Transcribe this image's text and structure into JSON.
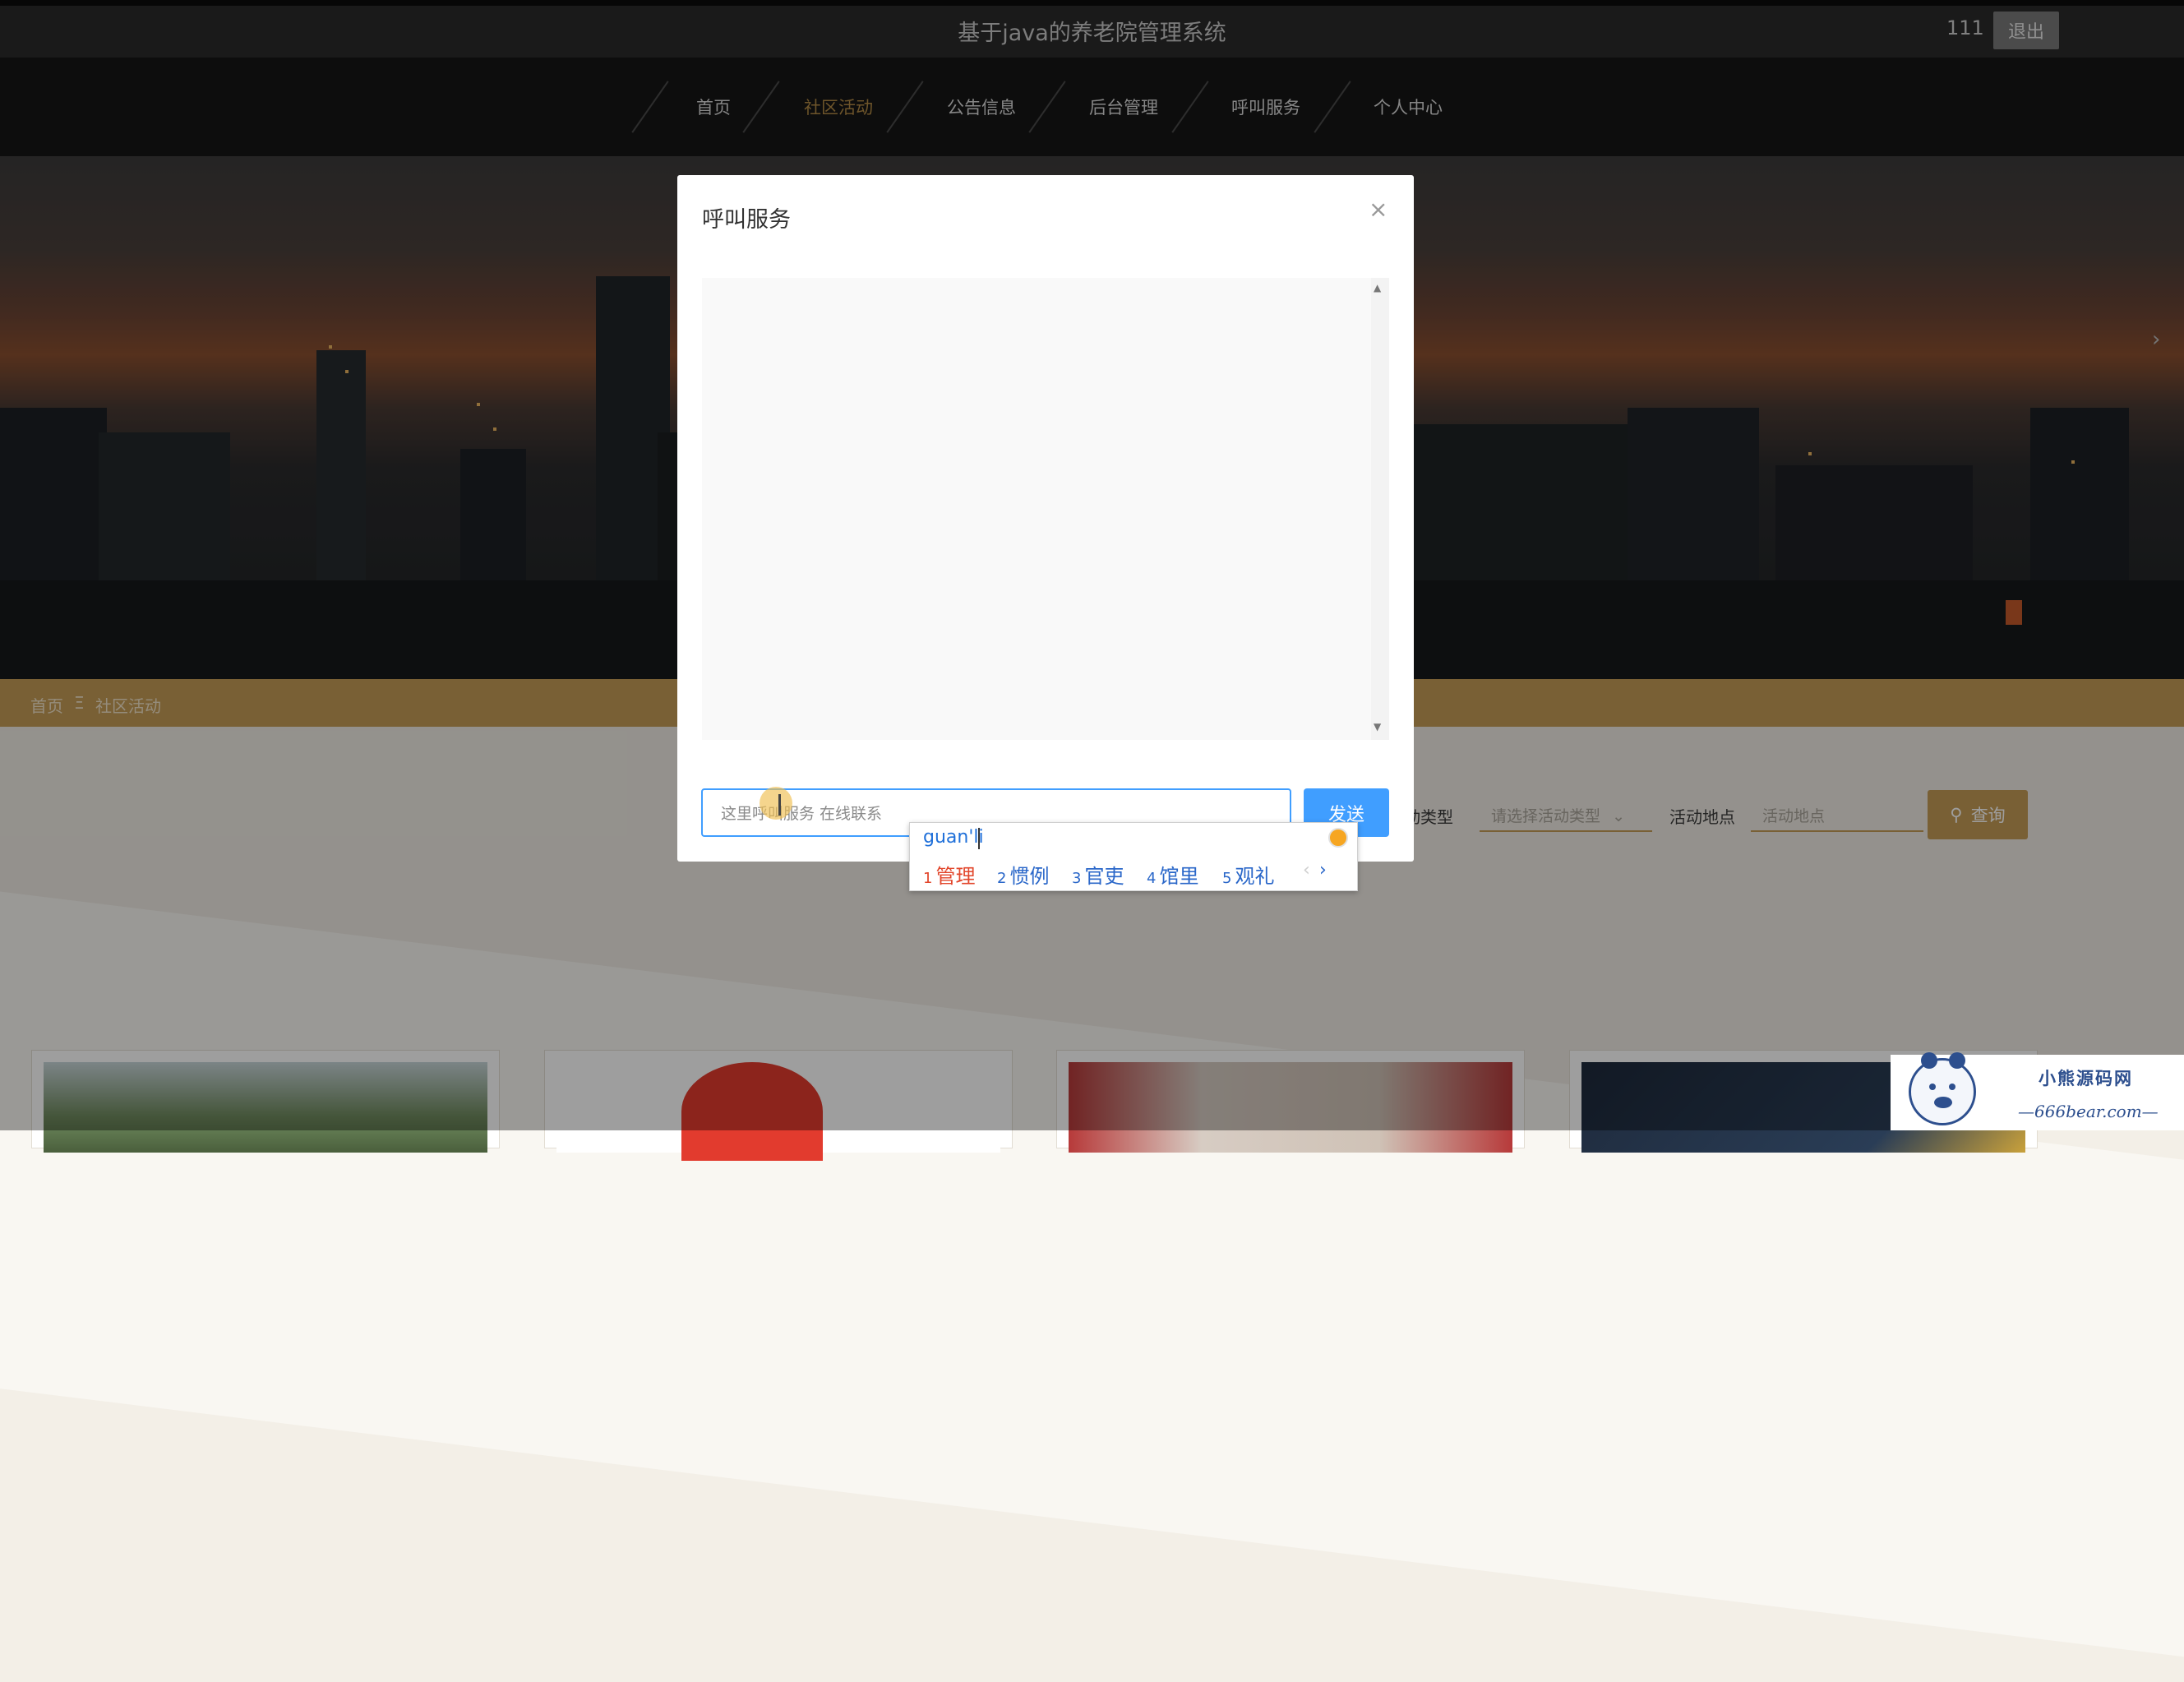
{
  "header": {
    "title": "基于java的养老院管理系统",
    "user": "111",
    "logout_label": "退出"
  },
  "nav": {
    "items": [
      {
        "label": "首页"
      },
      {
        "label": "社区活动"
      },
      {
        "label": "公告信息"
      },
      {
        "label": "后台管理"
      },
      {
        "label": "呼叫服务"
      },
      {
        "label": "个人中心"
      }
    ],
    "active": "社区活动"
  },
  "hero": {
    "next_arrow": "›"
  },
  "breadcrumb": {
    "home": "首页",
    "separator": "Ξ",
    "current": "社区活动"
  },
  "filters": {
    "type_label": "活动类型",
    "type_placeholder": "请选择活动类型",
    "location_label": "活动地点",
    "location_placeholder": "活动地点",
    "search_label": "查询"
  },
  "dialog": {
    "title": "呼叫服务",
    "close_glyph": "×",
    "input_value": "这里呼叫服务 在线联系",
    "send_label": "发送"
  },
  "ime": {
    "pinyin": "guan'li",
    "candidates": [
      {
        "num": "1",
        "text": "管理"
      },
      {
        "num": "2",
        "text": "惯例"
      },
      {
        "num": "3",
        "text": "官吏"
      },
      {
        "num": "4",
        "text": "馆里"
      },
      {
        "num": "5",
        "text": "观礼"
      }
    ],
    "prev": "‹",
    "next": "›"
  },
  "watermark": {
    "title": "小熊源码网",
    "url": "—666bear.com—"
  },
  "colors": {
    "accent": "#c39b56",
    "primary": "#409eff",
    "topbar": "#2b2b2b",
    "nav": "#161616"
  }
}
